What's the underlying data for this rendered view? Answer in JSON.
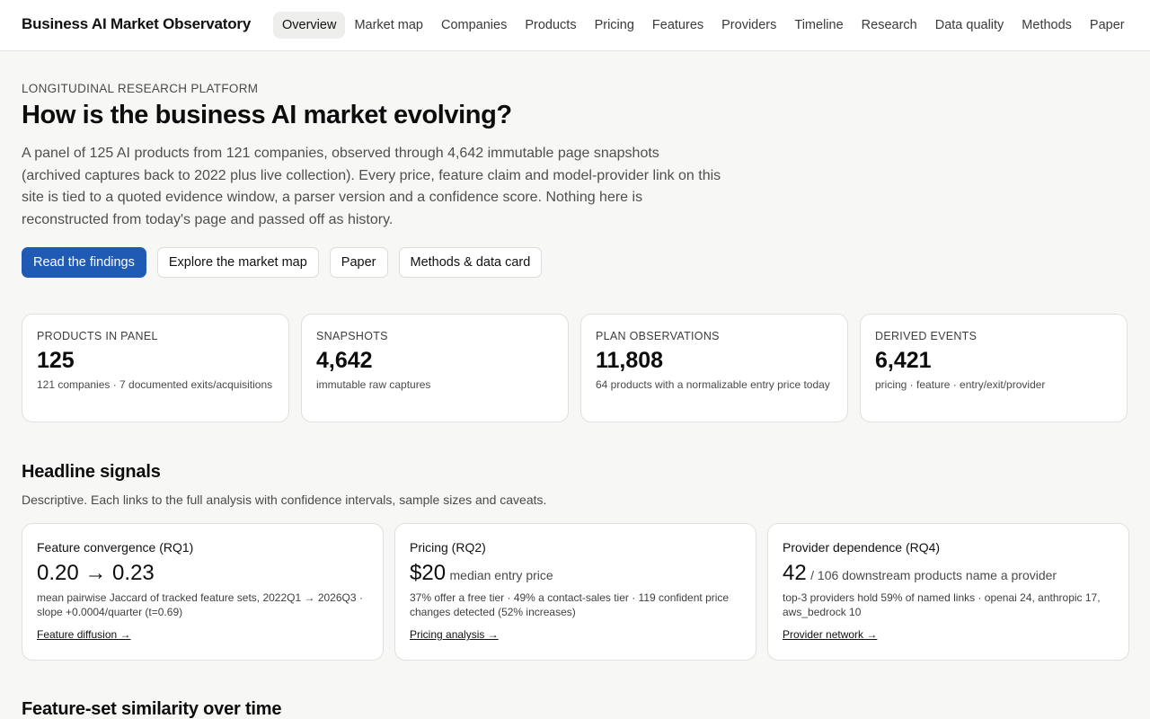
{
  "header": {
    "brand": "Business AI Market Observatory",
    "nav": [
      "Overview",
      "Market map",
      "Companies",
      "Products",
      "Pricing",
      "Features",
      "Providers",
      "Timeline",
      "Research",
      "Data quality",
      "Methods",
      "Paper"
    ],
    "active": "Overview"
  },
  "hero": {
    "eyebrow": "LONGITUDINAL RESEARCH PLATFORM",
    "title": "How is the business AI market evolving?",
    "description": "A panel of 125 AI products from 121 companies, observed through 4,642 immutable page snapshots (archived captures back to 2022 plus live collection). Every price, feature claim and model-provider link on this site is tied to a quoted evidence window, a parser version and a confidence score. Nothing here is reconstructed from today's page and passed off as history.",
    "buttons": {
      "findings": "Read the findings",
      "market_map": "Explore the market map",
      "paper": "Paper",
      "methods": "Methods & data card"
    }
  },
  "stats": [
    {
      "label": "PRODUCTS IN PANEL",
      "value": "125",
      "sub": "121 companies · 7 documented exits/acquisitions"
    },
    {
      "label": "SNAPSHOTS",
      "value": "4,642",
      "sub": "immutable raw captures"
    },
    {
      "label": "PLAN OBSERVATIONS",
      "value": "11,808",
      "sub": "64 products with a normalizable entry price today"
    },
    {
      "label": "DERIVED EVENTS",
      "value": "6,421",
      "sub": "pricing · feature · entry/exit/provider"
    }
  ],
  "signals_section": {
    "title": "Headline signals",
    "description": "Descriptive. Each links to the full analysis with confidence intervals, sample sizes and caveats."
  },
  "signals": [
    {
      "title": "Feature convergence (RQ1)",
      "big": "0.20 → 0.23",
      "small": "",
      "note": "mean pairwise Jaccard of tracked feature sets, 2022Q1 → 2026Q3 · slope +0.0004/quarter (t=0.69)",
      "link": "Feature diffusion →"
    },
    {
      "title": "Pricing (RQ2)",
      "big": "$20",
      "small": "median entry price",
      "note": "37% offer a free tier · 49% a contact-sales tier · 119 confident price changes detected (52% increases)",
      "link": "Pricing analysis →"
    },
    {
      "title": "Provider dependence (RQ4)",
      "big": "42",
      "small": "/ 106 downstream products name a provider",
      "note": "top-3 providers hold 59% of named links · openai 24, anthropic 17, aws_bedrock 10",
      "link": "Provider network →"
    }
  ],
  "next_section": {
    "title": "Feature-set similarity over time"
  }
}
